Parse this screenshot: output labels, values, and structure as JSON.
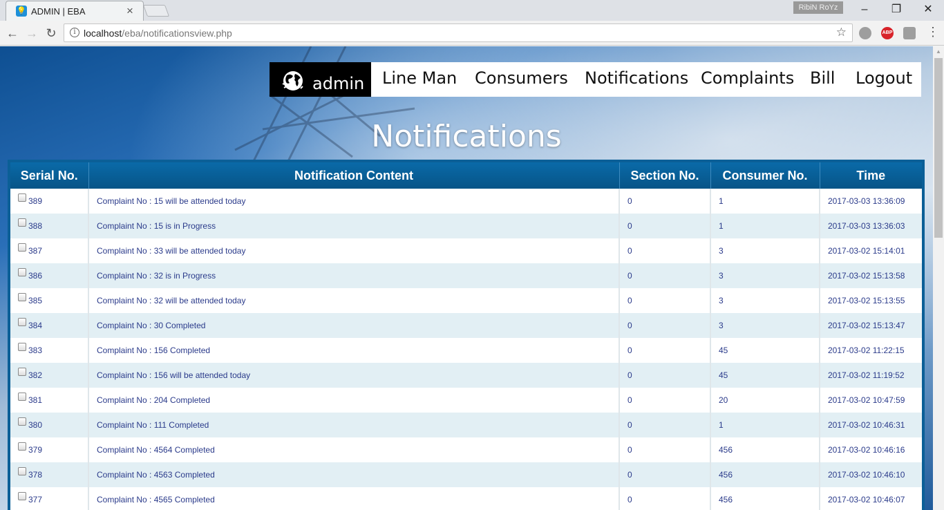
{
  "browser": {
    "tab_title": "ADMIN | EBA",
    "tab_close": "×",
    "profile_name": "RibiN RoYz",
    "window_controls": [
      "–",
      "❐",
      "✕"
    ],
    "url_host": "localhost",
    "url_path": "/eba/notificationsview.php",
    "extensions": [
      {
        "icon": "globe-extension-icon",
        "label": "",
        "color": "#9e9e9e"
      },
      {
        "icon": "adblock-plus-icon",
        "label": "ABP",
        "color": "#d8232a"
      },
      {
        "icon": "shield-extension-icon",
        "label": "",
        "color": "#9e9e9e"
      }
    ]
  },
  "site": {
    "brand": "admin",
    "nav": [
      "Line Man",
      "Consumers",
      "Notifications",
      "Complaints",
      "Bill",
      "Logout"
    ]
  },
  "page_title": "Notifications",
  "table": {
    "headers": [
      "Serial No.",
      "Notification Content",
      "Section No.",
      "Consumer No.",
      "Time"
    ],
    "rows": [
      {
        "serial": "389",
        "content": "Complaint No : 15 will be attended today",
        "section": "0",
        "consumer": "1",
        "time": "2017-03-03 13:36:09"
      },
      {
        "serial": "388",
        "content": "Complaint No : 15 is in Progress",
        "section": "0",
        "consumer": "1",
        "time": "2017-03-03 13:36:03"
      },
      {
        "serial": "387",
        "content": "Complaint No : 33 will be attended today",
        "section": "0",
        "consumer": "3",
        "time": "2017-03-02 15:14:01"
      },
      {
        "serial": "386",
        "content": "Complaint No : 32 is in Progress",
        "section": "0",
        "consumer": "3",
        "time": "2017-03-02 15:13:58"
      },
      {
        "serial": "385",
        "content": "Complaint No : 32 will be attended today",
        "section": "0",
        "consumer": "3",
        "time": "2017-03-02 15:13:55"
      },
      {
        "serial": "384",
        "content": "Complaint No : 30 Completed",
        "section": "0",
        "consumer": "3",
        "time": "2017-03-02 15:13:47"
      },
      {
        "serial": "383",
        "content": "Complaint No : 156 Completed",
        "section": "0",
        "consumer": "45",
        "time": "2017-03-02 11:22:15"
      },
      {
        "serial": "382",
        "content": "Complaint No : 156 will be attended today",
        "section": "0",
        "consumer": "45",
        "time": "2017-03-02 11:19:52"
      },
      {
        "serial": "381",
        "content": "Complaint No : 204 Completed",
        "section": "0",
        "consumer": "20",
        "time": "2017-03-02 10:47:59"
      },
      {
        "serial": "380",
        "content": "Complaint No : 111 Completed",
        "section": "0",
        "consumer": "1",
        "time": "2017-03-02 10:46:31"
      },
      {
        "serial": "379",
        "content": "Complaint No : 4564 Completed",
        "section": "0",
        "consumer": "456",
        "time": "2017-03-02 10:46:16"
      },
      {
        "serial": "378",
        "content": "Complaint No : 4563 Completed",
        "section": "0",
        "consumer": "456",
        "time": "2017-03-02 10:46:10"
      },
      {
        "serial": "377",
        "content": "Complaint No : 4565 Completed",
        "section": "0",
        "consumer": "456",
        "time": "2017-03-02 10:46:07"
      }
    ]
  }
}
